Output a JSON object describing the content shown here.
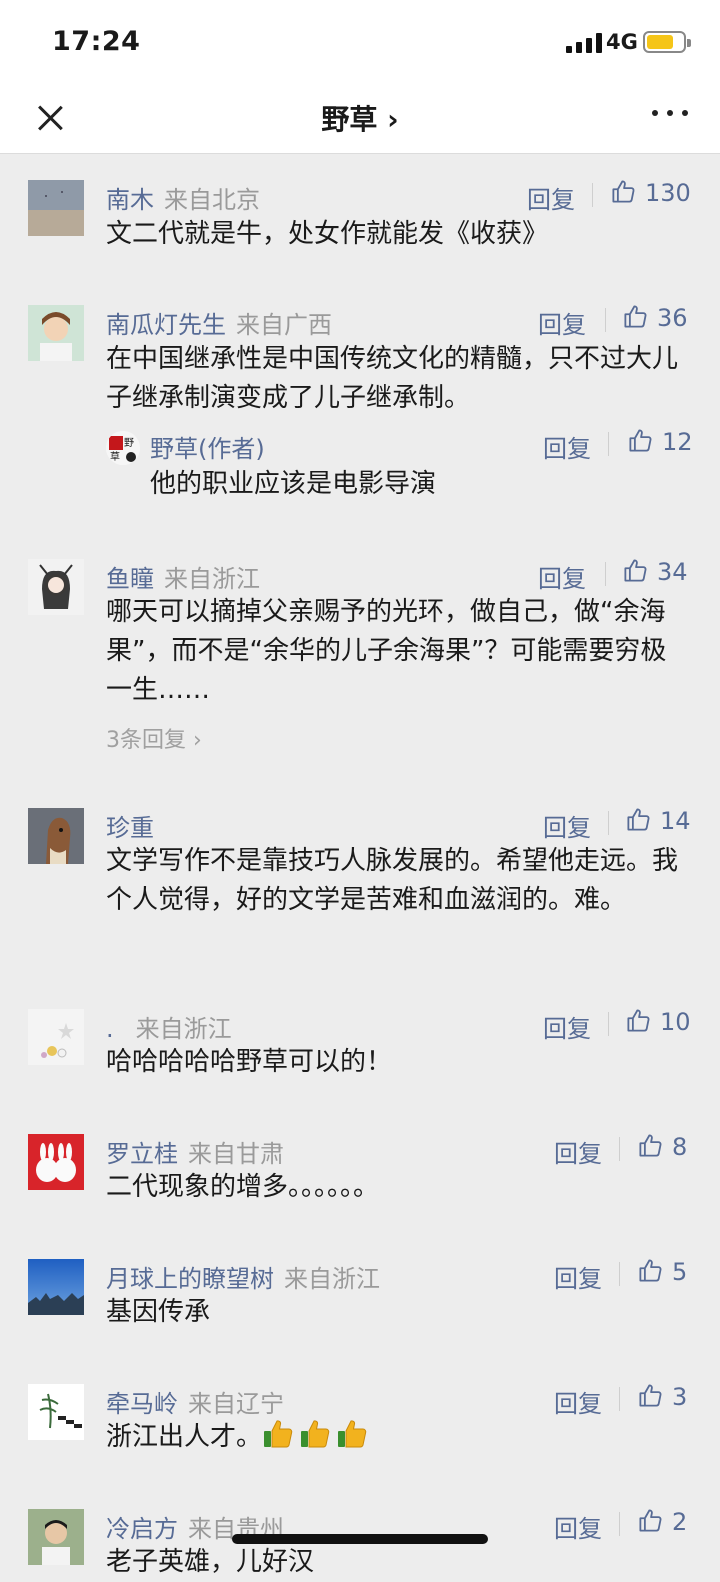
{
  "status": {
    "time": "17:24",
    "network": "4G"
  },
  "nav": {
    "title": "野草 ›"
  },
  "comments": [
    {
      "name": "南木",
      "location": "来自北京",
      "reply": "回复",
      "likes": "130",
      "text": "文二代就是牛，处女作就能发《收获》"
    },
    {
      "name": "南瓜灯先生",
      "location": "来自广西",
      "reply": "回复",
      "likes": "36",
      "text": "在中国继承性是中国传统文化的精髓，只不过大儿子继承制演变成了儿子继承制。",
      "author_reply": {
        "name": "野草(作者)",
        "avatar_text": "野草",
        "reply": "回复",
        "likes": "12",
        "text": "他的职业应该是电影导演"
      }
    },
    {
      "name": "鱼瞳",
      "location": "来自浙江",
      "reply": "回复",
      "likes": "34",
      "text": "哪天可以摘掉父亲赐予的光环，做自己，做“余海果”，而不是“余华的儿子余海果”？可能需要穷极一生……",
      "sub_replies": "3条回复 ›"
    },
    {
      "name": "珍重",
      "location": "",
      "reply": "回复",
      "likes": "14",
      "text": "文学写作不是靠技巧人脉发展的。希望他走远。我个人觉得，好的文学是苦难和血滋润的。难。"
    },
    {
      "name": ".",
      "location": "来自浙江",
      "reply": "回复",
      "likes": "10",
      "text": "哈哈哈哈哈野草可以的！"
    },
    {
      "name": "罗立桂",
      "location": "来自甘肃",
      "reply": "回复",
      "likes": "8",
      "text": "二代现象的增多。。。。。。"
    },
    {
      "name": "月球上的瞭望树",
      "location": "来自浙江",
      "reply": "回复",
      "likes": "5",
      "text": "基因传承"
    },
    {
      "name": "牵马岭",
      "location": "来自辽宁",
      "reply": "回复",
      "likes": "3",
      "text": "浙江出人才。",
      "emoji": [
        "thumbs-up",
        "thumbs-up",
        "thumbs-up"
      ]
    },
    {
      "name": "冷启方",
      "location": "来自贵州",
      "reply": "回复",
      "likes": "2",
      "text": "老子英雄，儿好汉"
    }
  ],
  "colors": {
    "link": "#576b95",
    "muted": "#9a9a9a",
    "background": "#ededed"
  }
}
